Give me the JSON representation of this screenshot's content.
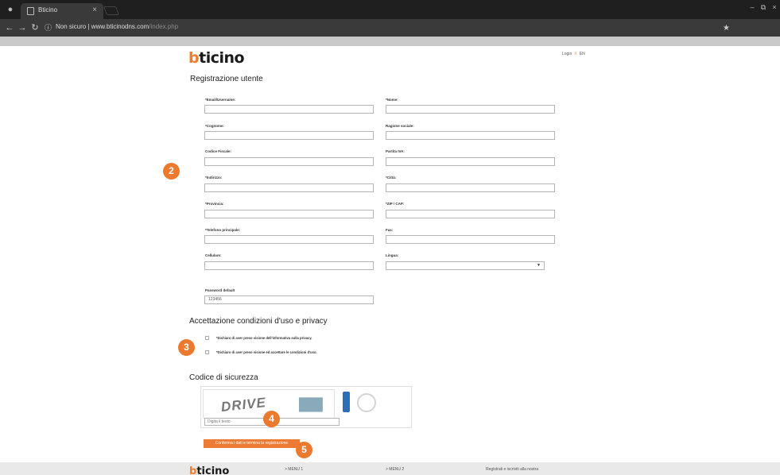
{
  "browser": {
    "tab_title": "Bticino",
    "url_host": "www.bticinodns.com",
    "url_path": "/index.php",
    "security_label": "Non sicuro",
    "url_separator": "|"
  },
  "header": {
    "logo_prefix": "b",
    "logo_rest": "ticino",
    "login_label": "Login",
    "lang_separator": "//",
    "lang_label": "EN"
  },
  "form": {
    "title": "Registrazione utente",
    "fields": {
      "email": {
        "label": "*Email/Username:",
        "value": ""
      },
      "nome": {
        "label": "*Nome:",
        "value": ""
      },
      "cognome": {
        "label": "*Cognome:",
        "value": ""
      },
      "ragione": {
        "label": "Ragione sociale:",
        "value": ""
      },
      "codice_fiscale": {
        "label": "Codice Fiscale:",
        "value": ""
      },
      "partita_iva": {
        "label": "Partita IVA:",
        "value": ""
      },
      "indirizzo": {
        "label": "*Indirizzo:",
        "value": ""
      },
      "citta": {
        "label": "*Città:",
        "value": ""
      },
      "provincia": {
        "label": "*Provincia:",
        "value": ""
      },
      "cap": {
        "label": "*ZIP / CAP:",
        "value": ""
      },
      "telefono": {
        "label": "*Telefono principale:",
        "value": ""
      },
      "fax": {
        "label": "Fax:",
        "value": ""
      },
      "cellulare": {
        "label": "Cellulare:",
        "value": ""
      },
      "lingua": {
        "label": "Lingua:",
        "value": ""
      },
      "password": {
        "label": "Password default",
        "value": "123456"
      }
    }
  },
  "privacy": {
    "title": "Accettazione condizioni d'uso e privacy",
    "check1": "*Dichiaro di aver preso visione dell'informativa sulla privacy.",
    "check2": "*Dichiaro di aver preso visione ed accettare le condizioni d'uso."
  },
  "security": {
    "title": "Codice di sicurezza",
    "captcha_word": "DRIVE",
    "captcha_input_placeholder": "Digita il testo"
  },
  "submit_label": "Conferma i dati e termina la registrazione",
  "badges": [
    "2",
    "3",
    "4",
    "5"
  ],
  "footer": {
    "logo_prefix": "b",
    "logo_rest": "ticino",
    "menu1": "> MENU 1",
    "menu2": "> MENU 2",
    "promo": "Registrati e iscriviti alla nostra"
  },
  "colors": {
    "accent": "#ee7b33",
    "chrome_dark": "#1f1f1f"
  }
}
